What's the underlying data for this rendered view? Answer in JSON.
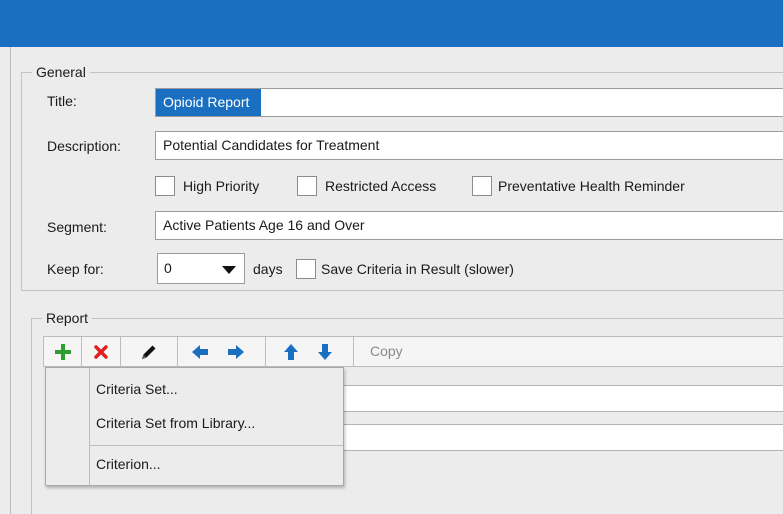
{
  "general": {
    "legend": "General",
    "title_label": "Title:",
    "title_value": "Opioid Report",
    "description_label": "Description:",
    "description_value": "Potential Candidates for Treatment",
    "checkboxes": [
      {
        "label": "High Priority",
        "checked": false
      },
      {
        "label": "Restricted Access",
        "checked": false
      },
      {
        "label": "Preventative Health Reminder",
        "checked": false
      }
    ],
    "segment_label": "Segment:",
    "segment_value": "Active Patients Age 16 and Over",
    "keep_for_label": "Keep for:",
    "keep_for_value": "0",
    "days_label": "days",
    "save_criteria_label": "Save Criteria in Result (slower)",
    "save_criteria_checked": false
  },
  "report": {
    "legend": "Report",
    "toolbar": {
      "add_icon": "plus-icon",
      "delete_icon": "x-icon",
      "edit_icon": "pencil-icon",
      "copy_label": "Copy"
    },
    "menu_items": [
      "Criteria Set...",
      "Criteria Set from Library...",
      "Criterion..."
    ]
  },
  "colors": {
    "titlebar": "#1a6fc0",
    "selection": "#1b6fc1",
    "add": "#2f9e32",
    "delete": "#e02020",
    "arrows": "#1b6fc1"
  }
}
